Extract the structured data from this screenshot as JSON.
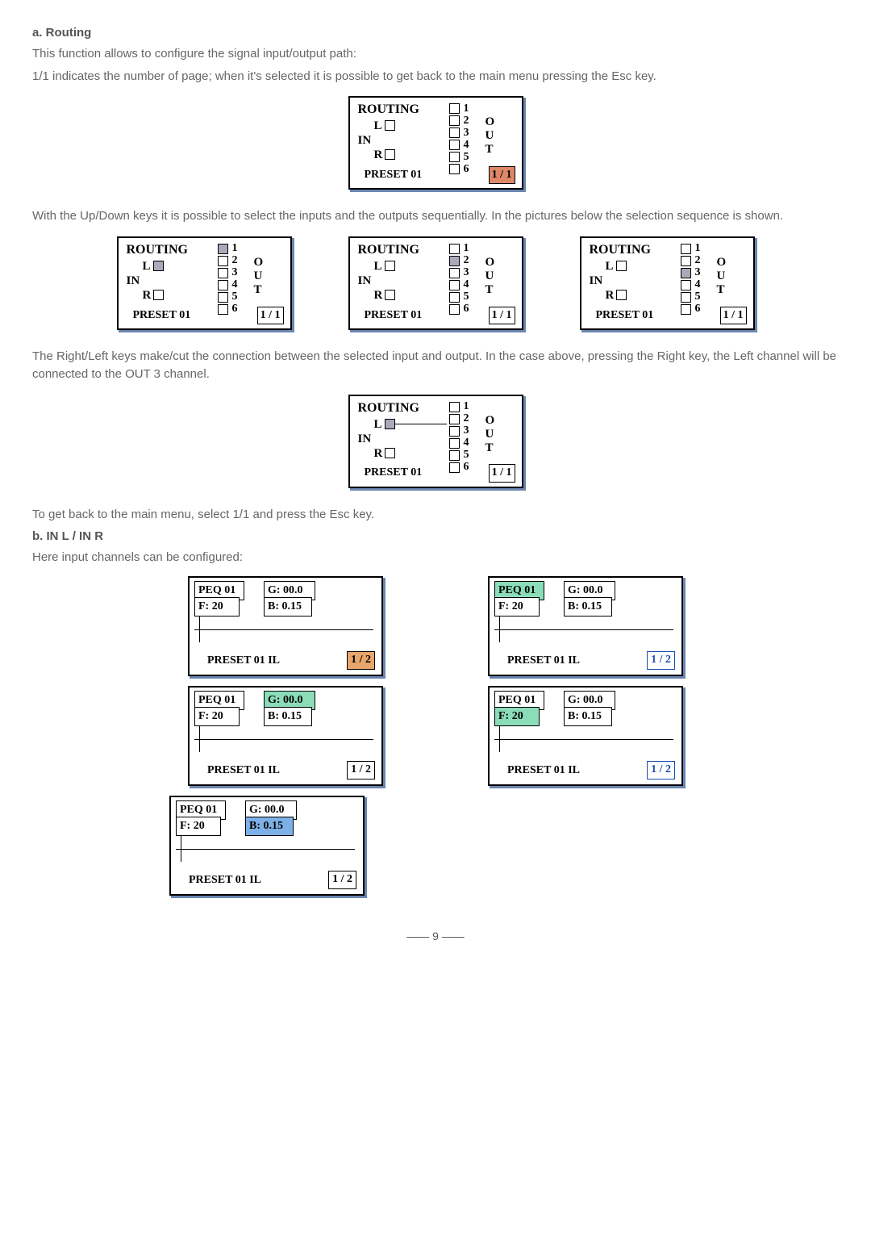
{
  "doc": {
    "section_a": "a. Routing",
    "p1": "This function allows to configure the signal input/output path:",
    "p2": "1/1 indicates the number of page; when it's selected it is possible to get back to the main menu pressing the Esc key.",
    "p3": "With the Up/Down keys it is possible to select the inputs and the outputs sequentially. In the pictures below the selection sequence is shown.",
    "p4": "The Right/Left keys make/cut the connection between the selected input and output. In the case above, pressing the Right key, the Left channel will be connected to the OUT 3 channel.",
    "p5": "To get back to the main menu, select 1/1 and press the Esc key.",
    "section_b": "b. IN L / IN R",
    "p6": "Here input channels can be configured:",
    "page_number": "9"
  },
  "routing": {
    "title": "ROUTING",
    "in": "IN",
    "l": "L",
    "r": "R",
    "preset": "PRESET 01",
    "out_label_o": "O",
    "out_label_u": "U",
    "out_label_t": "T",
    "nums": [
      "1",
      "2",
      "3",
      "4",
      "5",
      "6"
    ],
    "page": "1 / 1"
  },
  "peq_labels": {
    "peq": "PEQ 01",
    "g": "G: 00.0",
    "f": "F:   20",
    "b": "B: 0.15",
    "preset": "PRESET 01  IL",
    "page": "1 / 2"
  }
}
